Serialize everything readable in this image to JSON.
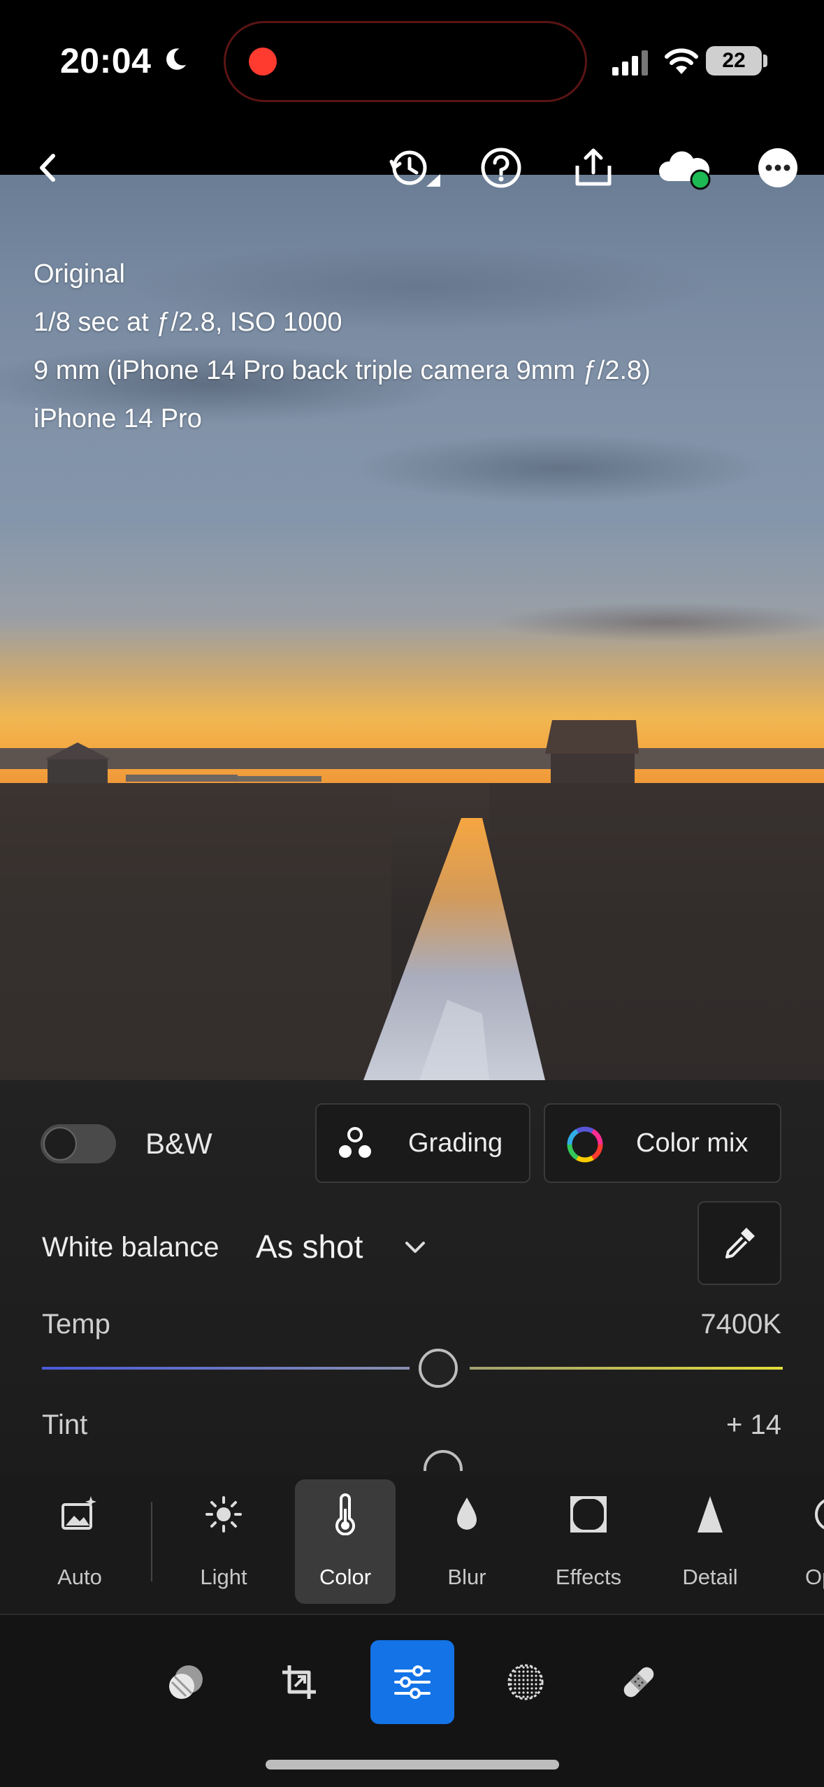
{
  "status_bar": {
    "time": "20:04",
    "battery": "22",
    "icons": [
      "moon-icon",
      "recording-dot",
      "cellular-signal-icon",
      "wifi-icon",
      "battery-icon"
    ]
  },
  "top_toolbar": {
    "icons": [
      "back-chevron-icon",
      "history-icon",
      "help-icon",
      "share-icon",
      "cloud-sync-icon",
      "more-icon"
    ]
  },
  "photo_info": {
    "line1": "Original",
    "line2": "1/8 sec at ƒ/2.8, ISO 1000",
    "line3": "9 mm (iPhone 14 Pro back triple camera 9mm ƒ/2.8)",
    "line4": "iPhone 14 Pro"
  },
  "color_panel": {
    "bw_label": "B&W",
    "bw_enabled": false,
    "grading_label": "Grading",
    "color_mix_label": "Color mix",
    "white_balance_label": "White balance",
    "white_balance_value": "As shot",
    "temp": {
      "label": "Temp",
      "value": "7400K",
      "position": 0.5
    },
    "tint": {
      "label": "Tint",
      "value": "+ 14"
    }
  },
  "tabs": [
    {
      "label": "Auto",
      "icon": "auto-enhance-icon",
      "active": false
    },
    {
      "label": "Light",
      "icon": "sun-icon",
      "active": false
    },
    {
      "label": "Color",
      "icon": "thermometer-icon",
      "active": true
    },
    {
      "label": "Blur",
      "icon": "drop-icon",
      "active": false
    },
    {
      "label": "Effects",
      "icon": "vignette-icon",
      "active": false
    },
    {
      "label": "Detail",
      "icon": "triangle-icon",
      "active": false
    },
    {
      "label": "Op",
      "icon": "optics-icon",
      "active": false
    }
  ],
  "tools": [
    {
      "name": "presets-icon",
      "active": false
    },
    {
      "name": "crop-icon",
      "active": false
    },
    {
      "name": "edit-sliders-icon",
      "active": true
    },
    {
      "name": "masking-icon",
      "active": false
    },
    {
      "name": "healing-bandage-icon",
      "active": false
    }
  ],
  "colors": {
    "accent": "#1473e6",
    "panel_bg": "#1b1b1b",
    "recording": "#ff3b30",
    "cloud_status": "#1db954"
  }
}
